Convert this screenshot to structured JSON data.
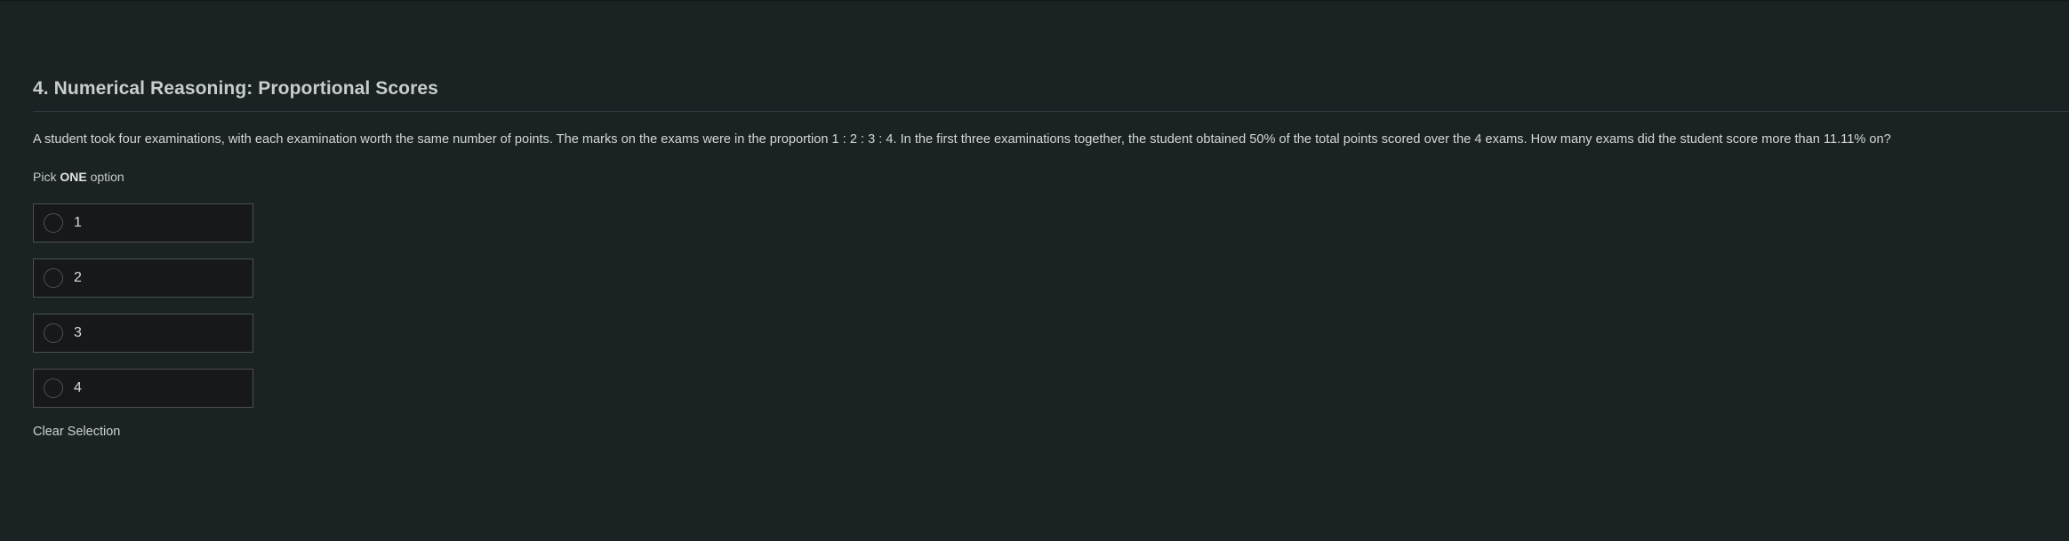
{
  "question": {
    "title": "4. Numerical Reasoning: Proportional Scores",
    "text": "A student took four examinations, with each examination worth the same number of points. The marks on the exams were in the proportion 1 : 2 : 3 : 4. In the first three examinations together, the student obtained 50% of the total points scored over the 4 exams. How many exams did the student score more than 11.11% on?",
    "instruction_prefix": "Pick ",
    "instruction_emphasis": "ONE",
    "instruction_suffix": " option",
    "options": [
      {
        "label": "1",
        "selected": false
      },
      {
        "label": "2",
        "selected": false
      },
      {
        "label": "3",
        "selected": false
      },
      {
        "label": "4",
        "selected": false
      }
    ],
    "clear_label": "Clear Selection"
  }
}
